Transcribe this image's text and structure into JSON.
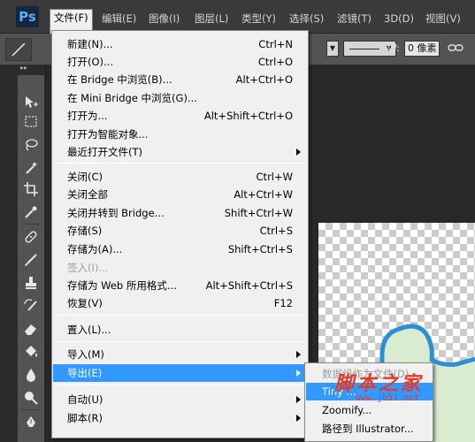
{
  "app": {
    "logo": "Ps"
  },
  "menubar": {
    "items": [
      {
        "label": "文件(F)",
        "active": true
      },
      {
        "label": "编辑(E)"
      },
      {
        "label": "图像(I)"
      },
      {
        "label": "图层(L)"
      },
      {
        "label": "类型(Y)"
      },
      {
        "label": "选择(S)"
      },
      {
        "label": "滤镜(T)"
      },
      {
        "label": "3D(D)"
      },
      {
        "label": "视图(V)"
      }
    ]
  },
  "options_bar": {
    "width_label": "W:",
    "width_value": "0 像素"
  },
  "file_menu": {
    "items": [
      {
        "label": "新建(N)...",
        "shortcut": "Ctrl+N"
      },
      {
        "label": "打开(O)...",
        "shortcut": "Ctrl+O"
      },
      {
        "label": "在 Bridge 中浏览(B)...",
        "shortcut": "Alt+Ctrl+O"
      },
      {
        "label": "在 Mini Bridge 中浏览(G)...",
        "shortcut": ""
      },
      {
        "label": "打开为...",
        "shortcut": "Alt+Shift+Ctrl+O"
      },
      {
        "label": "打开为智能对象...",
        "shortcut": ""
      },
      {
        "label": "最近打开文件(T)",
        "shortcut": ""
      },
      {
        "label": "关闭(C)",
        "shortcut": "Ctrl+W"
      },
      {
        "label": "关闭全部",
        "shortcut": "Alt+Ctrl+W"
      },
      {
        "label": "关闭并转到 Bridge...",
        "shortcut": "Shift+Ctrl+W"
      },
      {
        "label": "存储(S)",
        "shortcut": "Ctrl+S"
      },
      {
        "label": "存储为(A)...",
        "shortcut": "Shift+Ctrl+S"
      },
      {
        "label": "签入(I)...",
        "shortcut": ""
      },
      {
        "label": "存储为 Web 所用格式...",
        "shortcut": "Alt+Shift+Ctrl+S"
      },
      {
        "label": "恢复(V)",
        "shortcut": "F12"
      },
      {
        "label": "置入(L)...",
        "shortcut": ""
      },
      {
        "label": "导入(M)",
        "shortcut": ""
      },
      {
        "label": "导出(E)",
        "shortcut": ""
      },
      {
        "label": "自动(U)",
        "shortcut": ""
      },
      {
        "label": "脚本(R)",
        "shortcut": ""
      }
    ]
  },
  "export_menu": {
    "items": [
      {
        "label": "数据组作为文件(D)..."
      },
      {
        "label": "Tiny ..."
      },
      {
        "label": "Zoomify..."
      },
      {
        "label": "路径到 Illustrator..."
      }
    ]
  },
  "watermark": {
    "title": "脚本之家",
    "url": "www.jb51.net"
  },
  "colors": {
    "menu_bg": "#f0f0f0",
    "highlight": "#3399ff",
    "path_stroke": "#2b8fd6",
    "shape_fill": "#d9ecd0",
    "watermark": "#e43a2b"
  }
}
